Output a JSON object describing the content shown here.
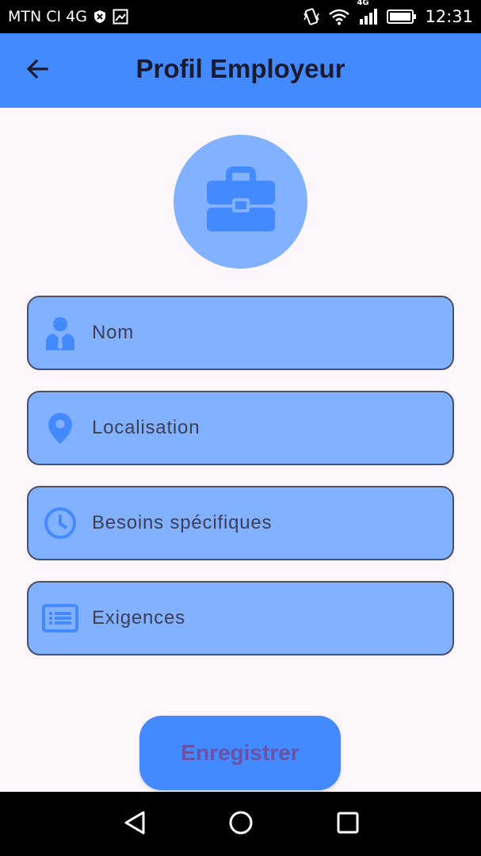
{
  "status_bar": {
    "carrier": "MTN CI 4G",
    "network_type": "4G",
    "time": "12:31"
  },
  "app_bar": {
    "title": "Profil Employeur",
    "back_icon": "arrow-left-icon"
  },
  "avatar": {
    "icon": "briefcase-icon"
  },
  "fields": [
    {
      "label": "Nom",
      "icon": "person-tie-icon"
    },
    {
      "label": "Localisation",
      "icon": "location-pin-icon"
    },
    {
      "label": "Besoins spécifiques",
      "icon": "clock-icon"
    },
    {
      "label": "Exigences",
      "icon": "list-icon"
    }
  ],
  "save_button": {
    "label": "Enregistrer"
  },
  "colors": {
    "primary": "#448aff",
    "field_fill": "#82b1ff",
    "icon_blue": "#448aff",
    "background": "#fdf7fc",
    "button_text": "#6a52a8"
  }
}
